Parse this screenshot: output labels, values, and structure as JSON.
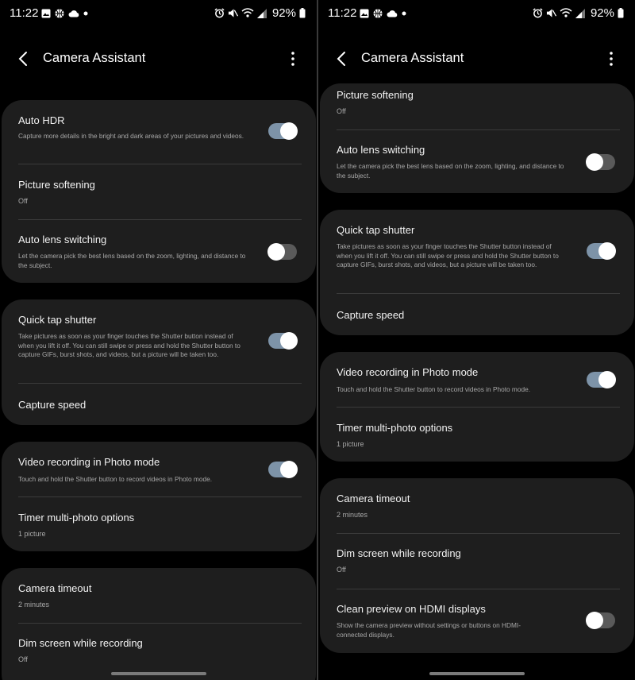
{
  "status_bar": {
    "time": "11:22",
    "battery": "92%"
  },
  "header": {
    "title": "Camera Assistant"
  },
  "settings": {
    "auto_hdr": {
      "title": "Auto HDR",
      "description": "Capture more details in the bright and dark areas of your pictures and videos.",
      "enabled": true
    },
    "picture_softening": {
      "title": "Picture softening",
      "value": "Off"
    },
    "auto_lens_switching": {
      "title": "Auto lens switching",
      "description": "Let the camera pick the best lens based on the zoom, lighting, and distance to the subject.",
      "enabled": false
    },
    "quick_tap_shutter": {
      "title": "Quick tap shutter",
      "description": "Take pictures as soon as your finger touches the Shutter button instead of when you lift it off. You can still swipe or press and hold the Shutter button to capture GIFs, burst shots, and videos, but a picture will be taken too.",
      "enabled": true
    },
    "capture_speed": {
      "title": "Capture speed"
    },
    "video_recording_photo_mode": {
      "title": "Video recording in Photo mode",
      "description": "Touch and hold the Shutter button to record videos in Photo mode.",
      "enabled": true
    },
    "timer_multi_photo": {
      "title": "Timer multi-photo options",
      "value": "1 picture"
    },
    "camera_timeout": {
      "title": "Camera timeout",
      "value": "2 minutes"
    },
    "dim_screen": {
      "title": "Dim screen while recording",
      "value": "Off"
    },
    "clean_preview_hdmi": {
      "title": "Clean preview on HDMI displays",
      "description": "Show the camera preview without settings or buttons on HDMI-connected displays.",
      "enabled": false
    }
  },
  "colors": {
    "background": "#000000",
    "card": "#1e1e1e",
    "toggle_on": "#7d93a8",
    "toggle_off": "#5a5a5a"
  },
  "icons": [
    "back-arrow",
    "more-vertical",
    "alarm",
    "mute",
    "wifi-call",
    "signal",
    "battery",
    "gallery",
    "basketball",
    "cloud"
  ]
}
